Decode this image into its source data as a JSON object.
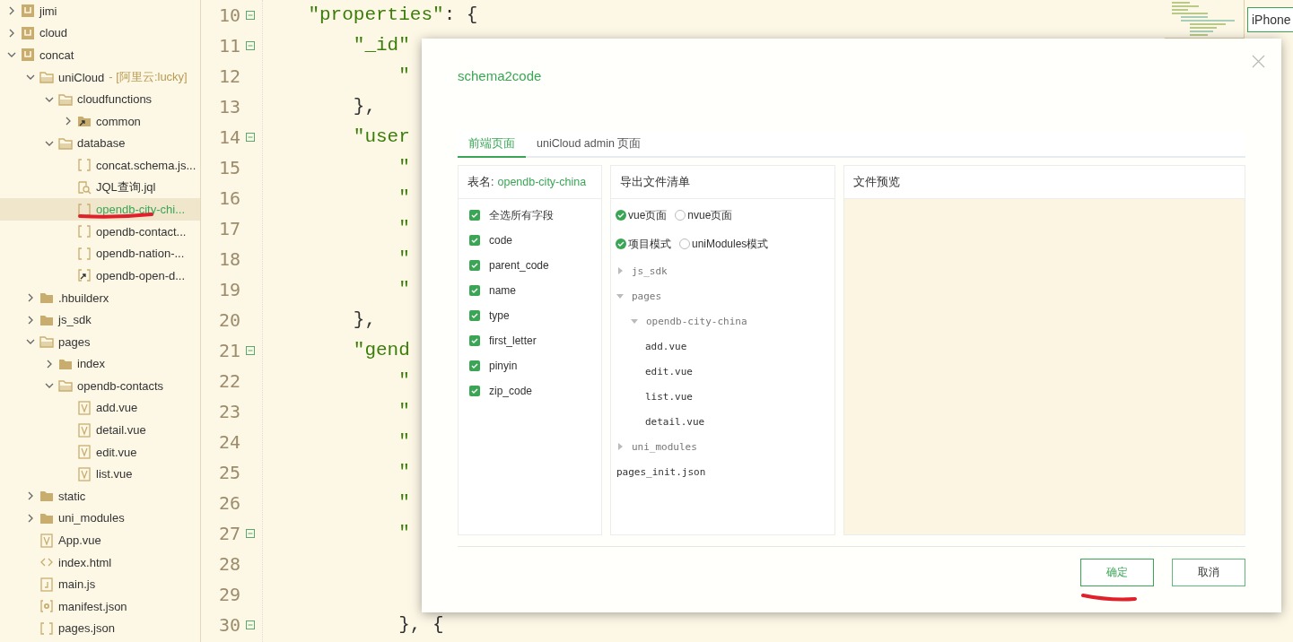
{
  "project_tree": [
    {
      "name": "jimi",
      "kind": "project",
      "expanded": false,
      "selected": false
    },
    {
      "name": "cloud",
      "kind": "project",
      "expanded": false,
      "selected": false
    },
    {
      "name": "concat",
      "kind": "project",
      "expanded": true,
      "selected": false,
      "children": [
        {
          "name": "uniCloud",
          "note": "- [阿里云:lucky]",
          "kind": "folder",
          "expanded": true,
          "selected": false,
          "children": [
            {
              "name": "cloudfunctions",
              "kind": "folder",
              "expanded": true,
              "selected": false,
              "children": [
                {
                  "name": "common",
                  "kind": "linked-folder",
                  "expanded": false,
                  "selected": false
                }
              ]
            },
            {
              "name": "database",
              "kind": "folder",
              "expanded": true,
              "selected": false,
              "children": [
                {
                  "name": "concat.schema.js...",
                  "kind": "json",
                  "selected": false
                },
                {
                  "name": "JQL查询.jql",
                  "kind": "query",
                  "selected": false
                },
                {
                  "name": "opendb-city-chi...",
                  "kind": "json",
                  "selected": true
                },
                {
                  "name": "opendb-contact...",
                  "kind": "json",
                  "selected": false
                },
                {
                  "name": "opendb-nation-...",
                  "kind": "json",
                  "selected": false
                },
                {
                  "name": "opendb-open-d...",
                  "kind": "linked-json",
                  "selected": false
                }
              ]
            }
          ]
        },
        {
          "name": ".hbuilderx",
          "kind": "folder",
          "expanded": false,
          "selected": false
        },
        {
          "name": "js_sdk",
          "kind": "folder",
          "expanded": false,
          "selected": false
        },
        {
          "name": "pages",
          "kind": "folder",
          "expanded": true,
          "selected": false,
          "children": [
            {
              "name": "index",
              "kind": "folder",
              "expanded": false,
              "selected": false
            },
            {
              "name": "opendb-contacts",
              "kind": "folder",
              "expanded": true,
              "selected": false,
              "children": [
                {
                  "name": "add.vue",
                  "kind": "vue",
                  "selected": false
                },
                {
                  "name": "detail.vue",
                  "kind": "vue",
                  "selected": false
                },
                {
                  "name": "edit.vue",
                  "kind": "vue",
                  "selected": false
                },
                {
                  "name": "list.vue",
                  "kind": "vue",
                  "selected": false
                }
              ]
            }
          ]
        },
        {
          "name": "static",
          "kind": "folder",
          "expanded": false,
          "selected": false
        },
        {
          "name": "uni_modules",
          "kind": "folder",
          "expanded": false,
          "selected": false
        },
        {
          "name": "App.vue",
          "kind": "vue",
          "selected": false
        },
        {
          "name": "index.html",
          "kind": "html",
          "selected": false
        },
        {
          "name": "main.js",
          "kind": "js",
          "selected": false
        },
        {
          "name": "manifest.json",
          "kind": "settings",
          "selected": false
        },
        {
          "name": "pages.json",
          "kind": "json",
          "selected": false
        }
      ]
    }
  ],
  "editor": {
    "lines": [
      {
        "number": "10",
        "foldable": true,
        "tokens": [
          {
            "text": "    \"properties\"",
            "kind": "string"
          },
          {
            "text": ": {",
            "kind": "punct"
          }
        ]
      },
      {
        "number": "11",
        "foldable": true,
        "tokens": [
          {
            "text": "        \"_id\"",
            "kind": "string"
          }
        ]
      },
      {
        "number": "12",
        "foldable": false,
        "tokens": [
          {
            "text": "            \"",
            "kind": "string"
          }
        ]
      },
      {
        "number": "13",
        "foldable": false,
        "tokens": [
          {
            "text": "        },",
            "kind": "punct"
          }
        ]
      },
      {
        "number": "14",
        "foldable": true,
        "tokens": [
          {
            "text": "        \"user",
            "kind": "string"
          }
        ]
      },
      {
        "number": "15",
        "foldable": false,
        "tokens": [
          {
            "text": "            \"",
            "kind": "string"
          }
        ]
      },
      {
        "number": "16",
        "foldable": false,
        "tokens": [
          {
            "text": "            \"",
            "kind": "string"
          }
        ]
      },
      {
        "number": "17",
        "foldable": false,
        "tokens": [
          {
            "text": "            \"",
            "kind": "string"
          }
        ]
      },
      {
        "number": "18",
        "foldable": false,
        "tokens": [
          {
            "text": "            \"",
            "kind": "string"
          }
        ]
      },
      {
        "number": "19",
        "foldable": false,
        "tokens": [
          {
            "text": "            \"",
            "kind": "string"
          }
        ]
      },
      {
        "number": "20",
        "foldable": false,
        "tokens": [
          {
            "text": "        },",
            "kind": "punct"
          }
        ]
      },
      {
        "number": "21",
        "foldable": true,
        "tokens": [
          {
            "text": "        \"gend",
            "kind": "string"
          }
        ]
      },
      {
        "number": "22",
        "foldable": false,
        "tokens": [
          {
            "text": "            \"",
            "kind": "string"
          }
        ]
      },
      {
        "number": "23",
        "foldable": false,
        "tokens": [
          {
            "text": "            \"",
            "kind": "string"
          }
        ]
      },
      {
        "number": "24",
        "foldable": false,
        "tokens": [
          {
            "text": "            \"",
            "kind": "string"
          }
        ]
      },
      {
        "number": "25",
        "foldable": false,
        "tokens": [
          {
            "text": "            \"",
            "kind": "string"
          }
        ]
      },
      {
        "number": "26",
        "foldable": false,
        "tokens": [
          {
            "text": "            \"",
            "kind": "string"
          }
        ]
      },
      {
        "number": "27",
        "foldable": true,
        "tokens": [
          {
            "text": "            \"",
            "kind": "string"
          }
        ]
      },
      {
        "number": "28",
        "foldable": false
      },
      {
        "number": "29",
        "foldable": false
      },
      {
        "number": "30",
        "foldable": true,
        "tokens": [
          {
            "text": "            }, {",
            "kind": "punct"
          }
        ]
      }
    ]
  },
  "device_field": {
    "value": "iPhone"
  },
  "dialog": {
    "title": "schema2code",
    "tabs": [
      {
        "label": "前端页面",
        "selected": true
      },
      {
        "label": "uniCloud admin 页面",
        "selected": false
      }
    ],
    "fields_panel": {
      "table_label": "表名:",
      "table_name": "opendb-city-china",
      "fields": [
        {
          "label": "全选所有字段",
          "checked": true
        },
        {
          "label": "code",
          "checked": true
        },
        {
          "label": "parent_code",
          "checked": true
        },
        {
          "label": "name",
          "checked": true
        },
        {
          "label": "type",
          "checked": true
        },
        {
          "label": "first_letter",
          "checked": true
        },
        {
          "label": "pinyin",
          "checked": true
        },
        {
          "label": "zip_code",
          "checked": true
        }
      ]
    },
    "export_panel": {
      "title": "导出文件清单",
      "option_groups": [
        [
          {
            "label": "vue页面",
            "selected": true
          },
          {
            "label": "nvue页面",
            "selected": false
          }
        ],
        [
          {
            "label": "项目模式",
            "selected": true
          },
          {
            "label": "uniModules模式",
            "selected": false
          }
        ]
      ],
      "files": [
        {
          "name": "js_sdk",
          "kind": "folder",
          "expanded": false
        },
        {
          "name": "pages",
          "kind": "folder",
          "expanded": true,
          "children": [
            {
              "name": "opendb-city-china",
              "kind": "folder",
              "expanded": true,
              "children": [
                {
                  "name": "add.vue",
                  "kind": "file"
                },
                {
                  "name": "edit.vue",
                  "kind": "file"
                },
                {
                  "name": "list.vue",
                  "kind": "file"
                },
                {
                  "name": "detail.vue",
                  "kind": "file"
                }
              ]
            }
          ]
        },
        {
          "name": "uni_modules",
          "kind": "folder",
          "expanded": false
        },
        {
          "name": "pages_init.json",
          "kind": "file"
        }
      ]
    },
    "preview_panel": {
      "title": "文件预览"
    },
    "buttons": [
      {
        "label": "确定",
        "kind": "primary"
      },
      {
        "label": "取消",
        "kind": "secondary"
      }
    ]
  }
}
